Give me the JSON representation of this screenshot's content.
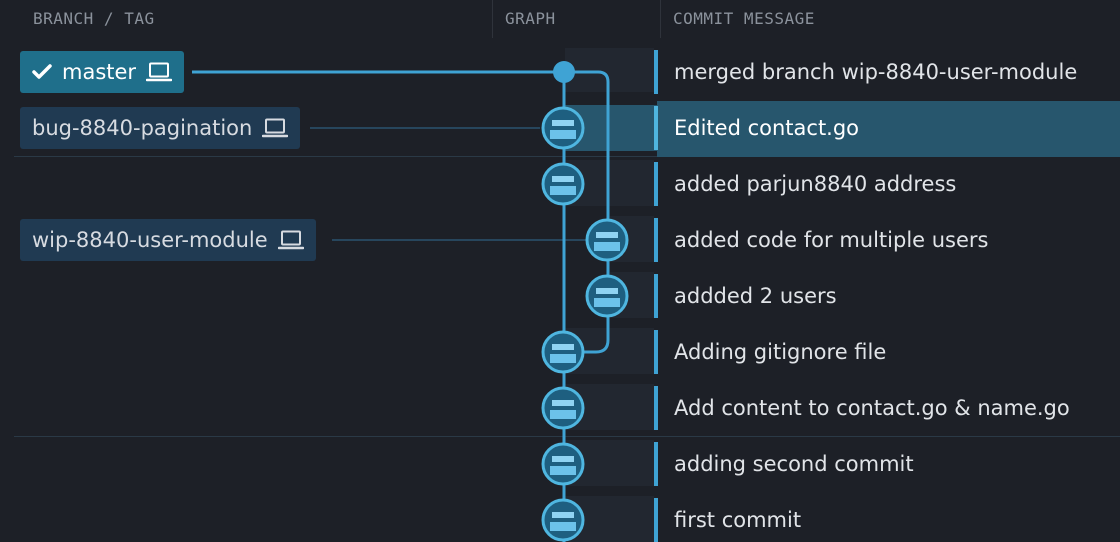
{
  "headers": {
    "branch_tag": "BRANCH / TAG",
    "graph": "GRAPH",
    "commit_message": "COMMIT MESSAGE"
  },
  "branches": [
    {
      "name": "master",
      "checked": true,
      "icon": "laptop-icon"
    },
    {
      "name": "bug-8840-pagination",
      "checked": false,
      "icon": "laptop-icon"
    },
    {
      "name": "wip-8840-user-module",
      "checked": false,
      "icon": "laptop-icon"
    }
  ],
  "commits": [
    {
      "message": "merged branch wip-8840-user-module",
      "lane": 0,
      "merge": true
    },
    {
      "message": "Edited contact.go",
      "lane": 0,
      "selected": true
    },
    {
      "message": "added parjun8840 address",
      "lane": 0
    },
    {
      "message": "added code for multiple users",
      "lane": 1
    },
    {
      "message": "addded 2 users",
      "lane": 1
    },
    {
      "message": "Adding gitignore file",
      "lane": 0
    },
    {
      "message": "Add content to contact.go & name.go",
      "lane": 0
    },
    {
      "message": "adding second commit",
      "lane": 0
    },
    {
      "message": "first commit",
      "lane": 0
    }
  ],
  "colors": {
    "background": "#1d2027",
    "graph_line": "#3fa3d4",
    "selected_row": "#27566d",
    "active_branch": "#1f6f8b",
    "branch_pill": "#203a52"
  }
}
